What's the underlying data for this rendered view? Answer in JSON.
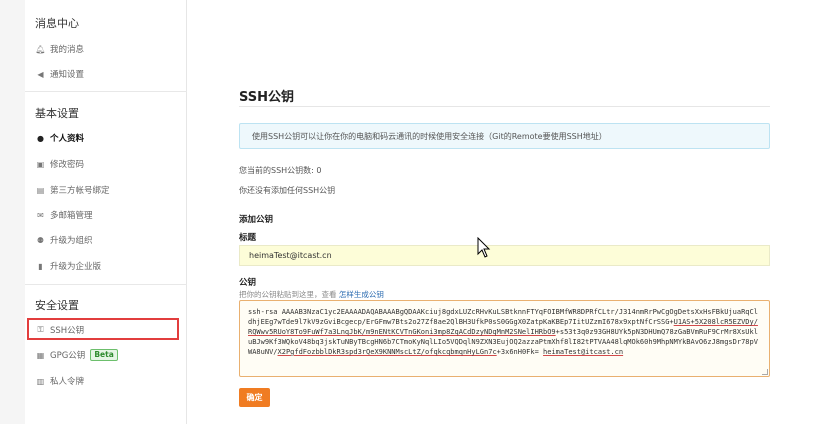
{
  "sidebar": {
    "messages": {
      "title": "消息中心",
      "items": [
        {
          "label": "我的消息",
          "icon": "bell-icon"
        },
        {
          "label": "通知设置",
          "icon": "speaker-icon"
        }
      ]
    },
    "basic": {
      "title": "基本设置",
      "items": [
        {
          "label": "个人资料",
          "icon": "user-icon",
          "active": true
        },
        {
          "label": "修改密码",
          "icon": "lock-icon"
        },
        {
          "label": "第三方帐号绑定",
          "icon": "link-icon"
        },
        {
          "label": "多邮箱管理",
          "icon": "mail-icon"
        },
        {
          "label": "升级为组织",
          "icon": "users-icon"
        },
        {
          "label": "升级为企业版",
          "icon": "building-icon"
        }
      ]
    },
    "security": {
      "title": "安全设置",
      "items": [
        {
          "label": "SSH公钥",
          "icon": "key-icon",
          "highlighted": true
        },
        {
          "label": "GPG公钥",
          "icon": "shield-icon",
          "badge": "Beta"
        },
        {
          "label": "私人令牌",
          "icon": "token-icon"
        }
      ]
    }
  },
  "main": {
    "title": "SSH公钥",
    "info": "使用SSH公钥可以让你在你的电脑和码云通讯的时候使用安全连接（Git的Remote要使用SSH地址）",
    "count_text": "您当前的SSH公钥数: 0",
    "empty_text": "你还没有添加任何SSH公钥",
    "add_heading": "添加公钥",
    "title_label": "标题",
    "title_value": "heimaTest@itcast.cn",
    "key_label": "公钥",
    "key_hint": "把你的公钥粘贴到这里，查看",
    "key_hint_link": "怎样生成公钥",
    "key_value_parts": [
      "ssh-rsa AAAAB3NzaC1yc2EAAAADAQABAAABgQDAAKciuj8gdxLUZcRHvKuLSBtknnFTYqFOIBMfWR8DPRfCLtr/J314nmRrPwCgOgDetsXxHsFBkUjuaRqCldhjEEg7wTde9l7kV9zGviBcgecp/ErGFmw7Bts2o27Zf8ae2QlBH3UfkP0sS0GGgX0ZatpKaKBEp7IitUZzmI678x9xptNfCrSSG+",
      "U1AS+5X208lcR5EZVDy/RQWwv5RUoY8To9FuWf7a3LnqJbK/m9nENtKCVTnGKoni3mp8ZqACdDzyNDqMnM2SNelIHRbO9",
      "+s53t3q0z93GH8UYk5pN3DHUmQ78zGaBVmRuF9CrMr8XsUkluBJw9Kf3WQkoV48bq3jskTuNByTBcgHN6b7CTmoKyNqlLIo5VQDqlN9ZXN3EujOQ2azzaPtmXhf8lI82tPTVAA48lqMOk60h9MhpNMYkBAvO6zJ8mgsDr78pVWA8uNV/",
      "X2PgfdFozbblDkR3spd3rQeX9KNNMscLtZ/ofqkcqbmqnHyLGn7c",
      "+3x6nH0Fk= ",
      "heimaTest@itcast.cn"
    ],
    "submit_label": "确定"
  },
  "colors": {
    "accent": "#f07c22",
    "highlight_border": "#e23d3d",
    "info_bg": "#eef8fc",
    "input_bg": "#fdfdd8",
    "link": "#2a6bb0",
    "beta_green": "#2e8b2e"
  }
}
